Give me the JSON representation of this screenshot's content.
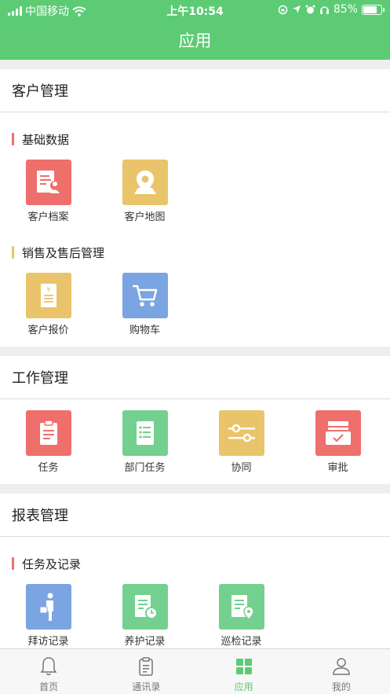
{
  "status_bar": {
    "carrier": "中国移动",
    "time": "上午10:54",
    "battery": "85%",
    "battery_level": 0.85
  },
  "header": {
    "title": "应用"
  },
  "colors": {
    "primary": "#5ccb74",
    "red": "#ee6f6c",
    "yellow": "#e9c46a",
    "blue": "#7ba4e3",
    "green": "#74d08f"
  },
  "customer": {
    "title": "客户管理",
    "basic": {
      "title": "基础数据",
      "items": [
        {
          "label": "客户档案",
          "icon": "customer-file-icon"
        },
        {
          "label": "客户地图",
          "icon": "map-pin-icon"
        }
      ]
    },
    "sales": {
      "title": "销售及售后管理",
      "items": [
        {
          "label": "客户报价",
          "icon": "quote-icon"
        },
        {
          "label": "购物车",
          "icon": "cart-icon"
        }
      ]
    }
  },
  "work": {
    "title": "工作管理",
    "items": [
      {
        "label": "任务",
        "icon": "clipboard-icon"
      },
      {
        "label": "部门任务",
        "icon": "list-icon"
      },
      {
        "label": "协同",
        "icon": "sliders-icon"
      },
      {
        "label": "审批",
        "icon": "approval-icon"
      }
    ]
  },
  "reports": {
    "title": "报表管理",
    "tasks": {
      "title": "任务及记录",
      "items": [
        {
          "label": "拜访记录",
          "icon": "visit-icon"
        },
        {
          "label": "养护记录",
          "icon": "maintenance-icon"
        },
        {
          "label": "巡检记录",
          "icon": "inspection-icon"
        }
      ]
    }
  },
  "tabbar": [
    {
      "label": "首页",
      "icon": "bell-icon"
    },
    {
      "label": "通讯录",
      "icon": "contacts-icon"
    },
    {
      "label": "应用",
      "icon": "apps-icon",
      "active": true
    },
    {
      "label": "我的",
      "icon": "user-icon"
    }
  ]
}
